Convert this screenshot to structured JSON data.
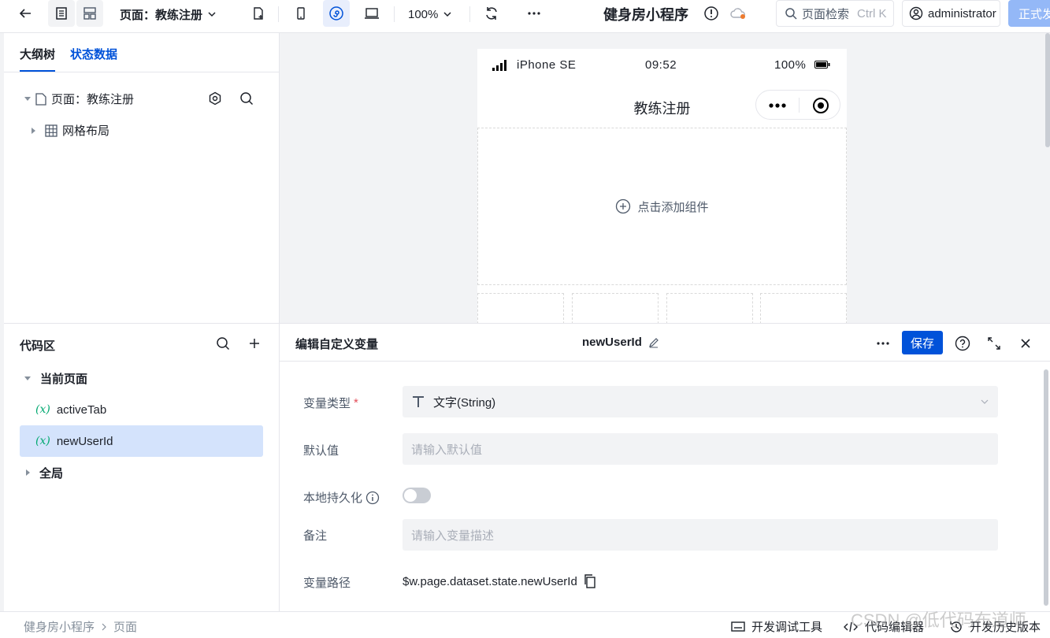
{
  "topbar": {
    "page_select": "页面：教练注册",
    "zoom": "100%",
    "app_title": "健身房小程序",
    "search_placeholder": "页面检索",
    "search_shortcut": "Ctrl K",
    "user": "administrator",
    "release": "正式发布"
  },
  "outline": {
    "tabs": [
      "大纲树",
      "状态数据"
    ],
    "page_node": "页面：教练注册",
    "grid_node": "网格布局"
  },
  "canvas": {
    "device": "iPhone SE",
    "time": "09:52",
    "battery": "100%",
    "nav_title": "教练注册",
    "add_component": "点击添加组件"
  },
  "code": {
    "title": "代码区",
    "current_page": "当前页面",
    "var_mark": "(x)",
    "vars": [
      "activeTab",
      "newUserId"
    ],
    "global": "全局"
  },
  "editor": {
    "title": "编辑自定义变量",
    "var_name": "newUserId",
    "save": "保存",
    "type_label": "变量类型",
    "required_mark": "*",
    "type_value": "文字(String)",
    "default_label": "默认值",
    "default_placeholder": "请输入默认值",
    "persist_label": "本地持久化",
    "persist_on": false,
    "note_label": "备注",
    "note_placeholder": "请输入变量描述",
    "path_label": "变量路径",
    "path_value": "$w.page.dataset.state.newUserId"
  },
  "statusbar": {
    "crumbs": [
      "健身房小程序",
      "页面"
    ],
    "debug": "开发调试工具",
    "code_editor": "代码编辑器",
    "history": "开发历史版本"
  },
  "watermark": "CSDN @低代码布道师",
  "colors": {
    "primary": "#0052d9",
    "selected_row": "#d4e3fc",
    "var_mark": "#00a870"
  }
}
